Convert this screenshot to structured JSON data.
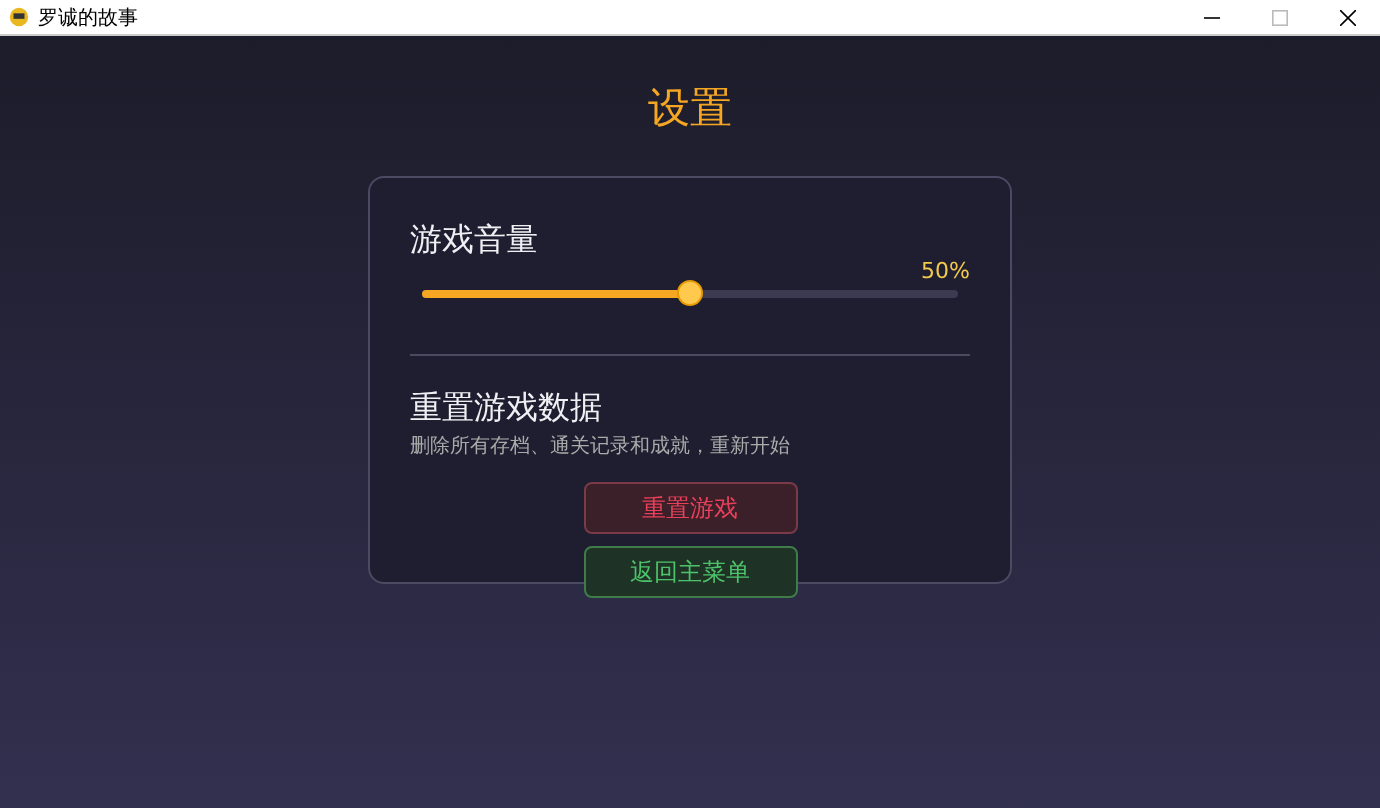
{
  "window": {
    "title": "罗诚的故事"
  },
  "title": "设置",
  "volume": {
    "label": "游戏音量",
    "reading": "50%",
    "level": 0.5
  },
  "reset_section": {
    "heading": "重置游戏数据",
    "description": "删除所有存档、通关记录和成就，重新开始"
  },
  "buttons": [
    {
      "label": "重置游戏",
      "kind": "danger"
    },
    {
      "label": "返回主菜单",
      "kind": "confirm"
    }
  ]
}
